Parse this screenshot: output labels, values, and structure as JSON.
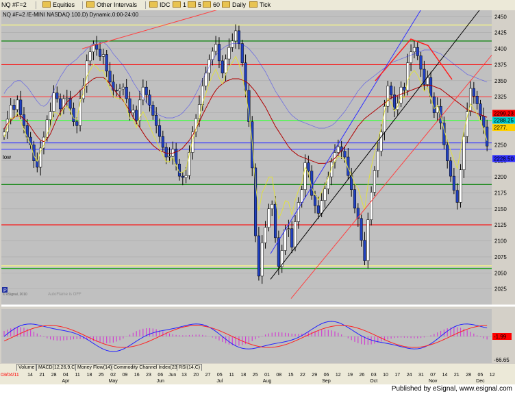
{
  "toolbar": {
    "symbol": "NQ #F=2",
    "equities": "Equities",
    "other_intervals": "Other Intervals",
    "intervals": [
      "IDC",
      "1",
      "5",
      "60",
      "Daily",
      "Tick"
    ]
  },
  "tabs": [
    "Volume",
    "MACD(12,26,9,C)",
    "Money Flow(14)",
    "Commodity Channel Index(23,C)",
    "RSI(14,C)"
  ],
  "footer": "Published by eSignal, www.esignal.com",
  "chart_data": {
    "type": "candlestick",
    "title": "NQ #F=2 /E-MINI NASDAQ 100,D) Dynamic,0:00-24:00",
    "ylim": [
      2000,
      2460
    ],
    "y_ticks": [
      2025,
      2050,
      2075,
      2100,
      2125,
      2150,
      2175,
      2200,
      2225,
      2250,
      2275,
      2300,
      2325,
      2350,
      2375,
      2400,
      2425,
      2450
    ],
    "x_axis_start": "03/04/11",
    "x_ticks": [
      "14",
      "21",
      "28",
      "Apr",
      "11",
      "18",
      "25",
      "May",
      "09",
      "16",
      "23",
      "31",
      "Jun",
      "13",
      "20",
      "27",
      "Jul",
      "11",
      "18",
      "25",
      "Aug",
      "08",
      "15",
      "22",
      "29",
      "Sep",
      "12",
      "19",
      "26",
      "Oct",
      "10",
      "17",
      "24",
      "31",
      "Nov",
      "14",
      "21",
      "28",
      "05",
      "12"
    ],
    "x_tick_lower": {
      "3": "Apr",
      "7": "May",
      "11": "Jun",
      "16": "Jul",
      "20": "Aug",
      "25": "Sep",
      "29": "Oct",
      "34": "Nov",
      "38": "Dec"
    },
    "x_ticks_upper_override": {
      "3": "04",
      "7": "02",
      "11": "06",
      "16": "05",
      "20": "01",
      "25": "06",
      "29": "03",
      "34": "07",
      "38": "05"
    },
    "price_labels": [
      {
        "value": "2299.23",
        "color": "#ff0000"
      },
      {
        "value": "2288.25",
        "color": "#00d0d0"
      },
      {
        "value": "2277.",
        "color": "#ffd000"
      },
      {
        "value": "2228.50",
        "color": "#3030ff"
      }
    ],
    "left_notes": [
      "low"
    ],
    "watermark": "AutoFlame is OFF",
    "copyright": "© eSignal, 2010",
    "pane_marker": "P",
    "macd_label": "-1.99",
    "lower_label": "-66.65",
    "horizontal_levels": [
      {
        "y": 2437,
        "color": "#ffff80"
      },
      {
        "y": 2412,
        "color": "#008000"
      },
      {
        "y": 2375,
        "color": "#ff0000"
      },
      {
        "y": 2325,
        "color": "#ff4040"
      },
      {
        "y": 2288,
        "color": "#40ff40"
      },
      {
        "y": 2253,
        "color": "#3030ff"
      },
      {
        "y": 2243,
        "color": "#5050ff"
      },
      {
        "y": 2188,
        "color": "#008000"
      },
      {
        "y": 2125,
        "color": "#ff0000"
      },
      {
        "y": 2061,
        "color": "#ffff80"
      },
      {
        "y": 2057,
        "color": "#00a000"
      }
    ],
    "closes": [
      2270,
      2290,
      2312,
      2305,
      2320,
      2297,
      2280,
      2262,
      2250,
      2225,
      2215,
      2245,
      2262,
      2289,
      2302,
      2331,
      2322,
      2306,
      2322,
      2323,
      2307,
      2286,
      2280,
      2322,
      2342,
      2381,
      2395,
      2407,
      2399,
      2388,
      2391,
      2365,
      2348,
      2335,
      2334,
      2337,
      2340,
      2322,
      2300,
      2304,
      2288,
      2320,
      2340,
      2328,
      2312,
      2296,
      2280,
      2263,
      2246,
      2231,
      2232,
      2243,
      2220,
      2201,
      2199,
      2202,
      2238,
      2270,
      2291,
      2313,
      2342,
      2362,
      2383,
      2396,
      2407,
      2381,
      2362,
      2384,
      2402,
      2412,
      2428,
      2408,
      2378,
      2335,
      2286,
      2214,
      2108,
      2045,
      2097,
      2121,
      2150,
      2157,
      2105,
      2060,
      2085,
      2118,
      2119,
      2090,
      2130,
      2160,
      2180,
      2222,
      2209,
      2171,
      2155,
      2143,
      2163,
      2181,
      2200,
      2223,
      2238,
      2247,
      2240,
      2231,
      2202,
      2180,
      2151,
      2135,
      2101,
      2069,
      2133,
      2176,
      2210,
      2240,
      2270,
      2310,
      2342,
      2328,
      2305,
      2315,
      2340,
      2335,
      2378,
      2395,
      2402,
      2389,
      2368,
      2344,
      2355,
      2325,
      2300,
      2310,
      2284,
      2250,
      2225,
      2201,
      2179,
      2160,
      2211,
      2263,
      2302,
      2338,
      2326,
      2314,
      2295,
      2278,
      2248
    ],
    "bollinger_upper": [
      2330,
      2338,
      2342,
      2348,
      2350,
      2350,
      2345,
      2340,
      2333,
      2325,
      2318,
      2312,
      2310,
      2314,
      2322,
      2334,
      2346,
      2356,
      2364,
      2372,
      2376,
      2380,
      2384,
      2390,
      2394,
      2400,
      2404,
      2408,
      2410,
      2410,
      2410,
      2406,
      2400,
      2392,
      2386,
      2380,
      2374,
      2366,
      2358,
      2348,
      2340,
      2332,
      2324,
      2316,
      2310,
      2304,
      2300,
      2296,
      2294,
      2292,
      2292,
      2292,
      2294,
      2296,
      2300,
      2306,
      2312,
      2320,
      2330,
      2340,
      2352,
      2362,
      2372,
      2382,
      2390,
      2396,
      2400,
      2404,
      2406,
      2408,
      2408,
      2408,
      2406,
      2404,
      2400,
      2394,
      2388,
      2380,
      2372,
      2364,
      2354,
      2344,
      2334,
      2326,
      2318,
      2310,
      2302,
      2296,
      2292,
      2288,
      2286,
      2284,
      2282,
      2280,
      2278,
      2276,
      2276,
      2276,
      2278,
      2280,
      2284,
      2290,
      2296,
      2302,
      2310,
      2318,
      2326,
      2334,
      2340,
      2346,
      2350,
      2354,
      2358,
      2362,
      2366,
      2370,
      2374,
      2378,
      2380,
      2382,
      2384,
      2386,
      2388,
      2390,
      2392,
      2394,
      2396,
      2398,
      2398,
      2398,
      2396,
      2394,
      2392,
      2388,
      2384,
      2380,
      2376,
      2372,
      2368,
      2364,
      2360,
      2358,
      2356,
      2354,
      2352,
      2350,
      2348
    ]
  }
}
